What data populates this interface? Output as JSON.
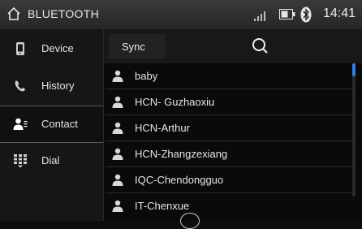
{
  "status": {
    "app_title": "BLUETOOTH",
    "time": "14:41"
  },
  "sidebar": {
    "items": [
      {
        "label": "Device",
        "icon": "phone-icon"
      },
      {
        "label": "History",
        "icon": "handset-icon"
      },
      {
        "label": "Contact",
        "icon": "contact-icon",
        "active": true
      },
      {
        "label": "Dial",
        "icon": "keypad-icon"
      }
    ]
  },
  "toolbar": {
    "sync_label": "Sync",
    "search_icon": "search-icon"
  },
  "contacts": [
    "baby",
    "HCN- Guzhaoxiu",
    "HCN-Arthur",
    "HCN-Zhangzexiang",
    "IQC-Chendongguo",
    "IT-Chenxue"
  ],
  "colors": {
    "accent": "#2f7fe0",
    "background": "#0a0a0a",
    "statusbar": "#2e2e2e"
  }
}
